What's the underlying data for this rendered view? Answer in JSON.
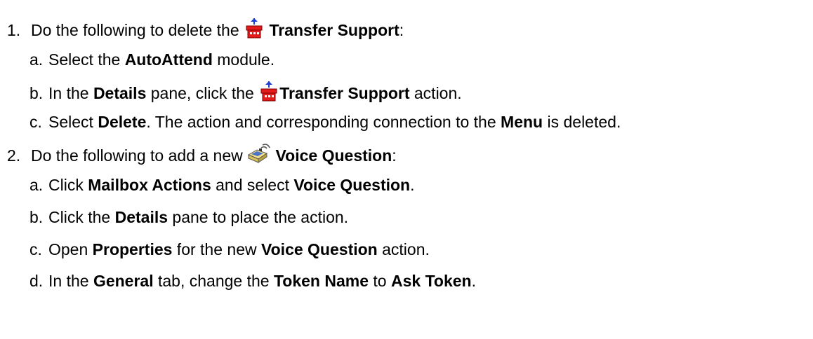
{
  "step1": {
    "num": "1.",
    "pre": "Do the following to delete the ",
    "icon": "transfer-icon",
    "bold": "Transfer Support",
    "post": ":",
    "subs": [
      {
        "num": "a.",
        "t1": "Select the ",
        "b1": "AutoAttend",
        "t2": " module."
      },
      {
        "num": "b.",
        "t1": "In the ",
        "b1": "Details",
        "t2": " pane, click the ",
        "b2": "Transfer Support",
        "t3": " action."
      },
      {
        "num": "c.",
        "t1": "Select ",
        "b1": "Delete",
        "t2": ". The action and corresponding connection to the ",
        "b2": "Menu",
        "t3": " is deleted."
      }
    ]
  },
  "step2": {
    "num": "2.",
    "pre": "Do the following to add a new ",
    "icon": "voice-question-icon",
    "bold": "Voice Question",
    "post": ":",
    "subs": [
      {
        "num": "a.",
        "t1": "Click ",
        "b1": "Mailbox Actions",
        "t2": " and select ",
        "b2": "Voice Question",
        "t3": "."
      },
      {
        "num": "b.",
        "t1": "Click the ",
        "b1": "Details",
        "t2": " pane to place the action."
      },
      {
        "num": "c.",
        "t1": "Open ",
        "b1": "Properties",
        "t2": " for the new ",
        "b2": "Voice Question",
        "t3": " action."
      },
      {
        "num": "d.",
        "t1": "In the ",
        "b1": "General",
        "t2": " tab, change the ",
        "b2": "Token Name",
        "t3": " to ",
        "b3": "Ask Token",
        "t4": "."
      }
    ]
  }
}
